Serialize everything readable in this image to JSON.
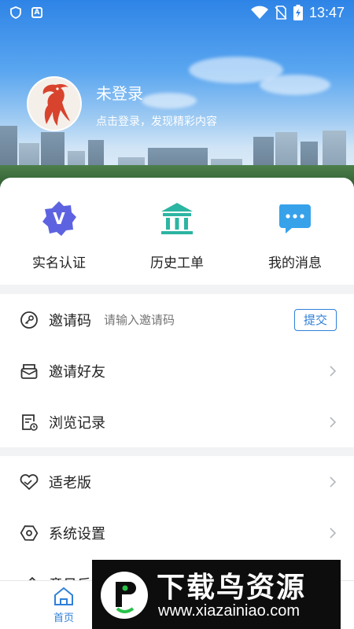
{
  "status_bar": {
    "time": "13:47",
    "left_icons": [
      "shield-icon",
      "a-box-icon"
    ],
    "right_icons": [
      "wifi-icon",
      "no-sim-icon",
      "battery-charging-icon"
    ]
  },
  "profile": {
    "name": "未登录",
    "subtitle": "点击登录，发现精彩内容"
  },
  "quick_actions": [
    {
      "label": "实名认证",
      "icon": "verified-badge-icon"
    },
    {
      "label": "历史工单",
      "icon": "bank-building-icon"
    },
    {
      "label": "我的消息",
      "icon": "chat-bubble-icon"
    }
  ],
  "invite": {
    "label": "邀请码",
    "placeholder": "请输入邀请码",
    "submit_label": "提交",
    "icon": "key-icon"
  },
  "menu_group_1": [
    {
      "label": "邀请好友",
      "icon": "envelope-icon"
    },
    {
      "label": "浏览记录",
      "icon": "history-doc-icon"
    }
  ],
  "menu_group_2": [
    {
      "label": "适老版",
      "icon": "heart-hands-icon"
    },
    {
      "label": "系统设置",
      "icon": "settings-hex-icon"
    },
    {
      "label": "意见反馈",
      "icon": "edit-icon"
    }
  ],
  "tabs": [
    {
      "label": "首页",
      "icon": "home-icon"
    }
  ],
  "colors": {
    "accent": "#2f80d9",
    "text": "#222222",
    "placeholder": "#9aa0a6"
  },
  "watermark": {
    "title": "下载鸟资源",
    "url": "www.xiazainiao.com"
  }
}
